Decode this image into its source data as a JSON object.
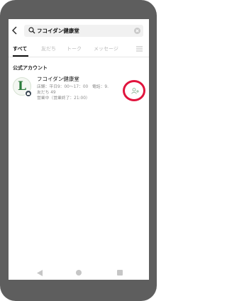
{
  "search": {
    "query": "フコイダン健康堂"
  },
  "tabs": [
    {
      "label": "すべて",
      "active": true
    },
    {
      "label": "友だち",
      "active": false
    },
    {
      "label": "トーク",
      "active": false
    },
    {
      "label": "メッセージ",
      "active": false
    }
  ],
  "section": {
    "title": "公式アカウント"
  },
  "result": {
    "name": "フコイダン健康堂",
    "line1": "店舗：平日9：00〜17：00　電話：9.",
    "line2": "友だち 49",
    "line3": "営業中（営業終了：21:00）"
  },
  "icons": {
    "back": "back-arrow-icon",
    "search": "search-icon",
    "clear": "clear-icon",
    "menu": "menu-icon",
    "verified": "verified-badge-icon",
    "add_friend": "add-friend-icon"
  },
  "colors": {
    "highlight": "#e0143d",
    "accent": "#2a7a3a",
    "phone_frame": "#5e5e5e"
  }
}
